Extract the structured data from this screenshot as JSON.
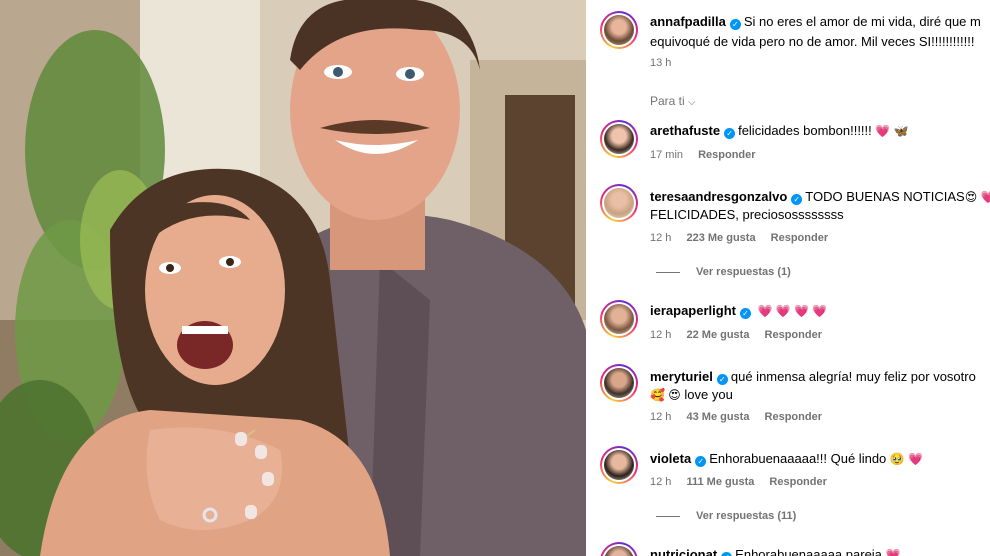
{
  "caption": {
    "username": "annafpadilla",
    "text_line1": "Si no eres el amor de mi vida, diré que m",
    "text_line2": "equivoqué de vida pero no de amor. Mil veces SI!!!!!!!!!!!!",
    "time": "13 h"
  },
  "filter_label": "Para ti",
  "comments": [
    {
      "username": "arethafuste",
      "text_line1": "felicidades bombon!!!!!!",
      "emojis": "💗 🦋",
      "time": "17 min",
      "likes": "",
      "reply_label": "Responder"
    },
    {
      "username": "teresaandresgonzalvo",
      "text_line1": "TODO BUENAS NOTICIAS",
      "emojis": "😍 💗",
      "text_line2": "FELICIDADES, preciosossssssss",
      "time": "12 h",
      "likes": "223 Me gusta",
      "reply_label": "Responder",
      "view_replies": "Ver respuestas (1)"
    },
    {
      "username": "ierapaperlight",
      "text_line1": "",
      "emojis": "💗 💗 💗 💗",
      "time": "12 h",
      "likes": "22 Me gusta",
      "reply_label": "Responder"
    },
    {
      "username": "meryturiel",
      "text_line1": "qué inmensa alegría! muy feliz por vosotro",
      "emojis": "🥰 😍",
      "text_line2": "love you",
      "time": "12 h",
      "likes": "43 Me gusta",
      "reply_label": "Responder"
    },
    {
      "username": "violeta",
      "text_line1": "Enhorabuenaaaaa!!! Qué lindo",
      "emojis": "🥹 💗",
      "time": "12 h",
      "likes": "111 Me gusta",
      "reply_label": "Responder",
      "view_replies": "Ver respuestas (11)"
    },
    {
      "username": "nutricionat",
      "text_line1": "Enhorabuenaaaaa pareja",
      "emojis": "💗"
    }
  ]
}
